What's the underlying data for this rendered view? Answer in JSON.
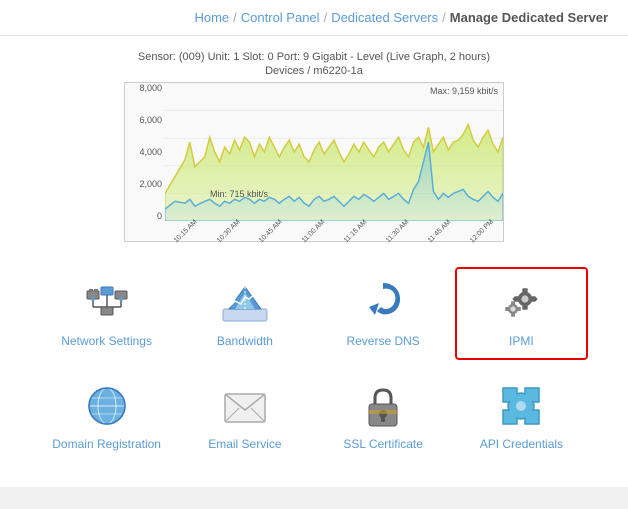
{
  "breadcrumb": {
    "home": "Home",
    "control_panel": "Control Panel",
    "dedicated_servers": "Dedicated Servers",
    "current": "Manage Dedicated Server"
  },
  "chart": {
    "title": "Sensor: (009) Unit: 1 Slot: 0 Port: 9 Gigabit - Level (Live Graph, 2 hours)",
    "subtitle": "Devices / m6220-1a",
    "y_labels": [
      "8,000",
      "6,000",
      "4,000",
      "2,000",
      "0"
    ],
    "y_unit": "kbit/s",
    "x_labels": [
      "10:15 AM",
      "10:30 AM",
      "10:45 AM",
      "11:00 AM",
      "11:15 AM",
      "11:30 AM",
      "11:45 AM",
      "12:00 PM"
    ],
    "max_label": "Max: 9,159 kbit/s",
    "min_label": "Min: 715 kbit/s"
  },
  "icons": [
    {
      "id": "network-settings",
      "label": "Network Settings",
      "icon": "network",
      "selected": false
    },
    {
      "id": "bandwidth",
      "label": "Bandwidth",
      "icon": "bandwidth",
      "selected": false
    },
    {
      "id": "reverse-dns",
      "label": "Reverse DNS",
      "icon": "reversedns",
      "selected": false
    },
    {
      "id": "ipmi",
      "label": "IPMI",
      "icon": "gear",
      "selected": true
    },
    {
      "id": "domain-registration",
      "label": "Domain Registration",
      "icon": "globe",
      "selected": false
    },
    {
      "id": "email-service",
      "label": "Email Service",
      "icon": "email",
      "selected": false
    },
    {
      "id": "ssl-certificate",
      "label": "SSL Certificate",
      "icon": "ssl",
      "selected": false
    },
    {
      "id": "api-credentials",
      "label": "API Credentials",
      "icon": "puzzle",
      "selected": false
    }
  ]
}
